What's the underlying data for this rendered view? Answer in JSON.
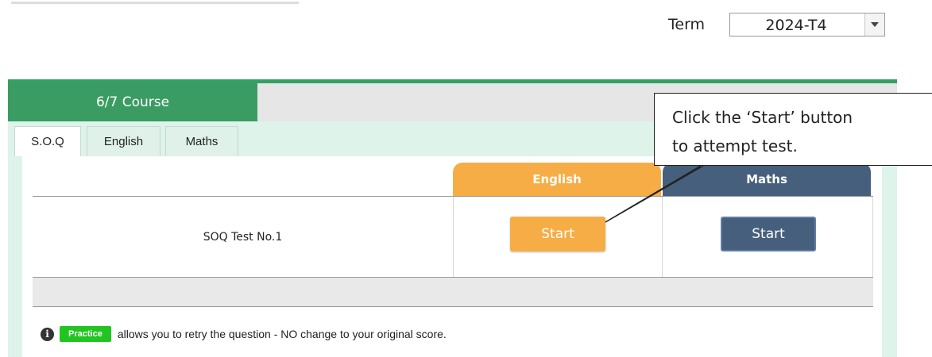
{
  "term": {
    "label": "Term",
    "value": "2024-T4"
  },
  "course": {
    "tab_label": "6/7 Course",
    "subtabs": [
      "S.O.Q",
      "English",
      "Maths"
    ],
    "active_subtab": "S.O.Q"
  },
  "table": {
    "columns": [
      "English",
      "Maths"
    ],
    "rows": [
      {
        "name": "SOQ Test No.1",
        "english_button": "Start",
        "maths_button": "Start"
      }
    ]
  },
  "info": {
    "badge": "Practice",
    "text": "allows you to retry the question - NO change to your original score."
  },
  "callout": {
    "line1": "Click the ‘Start’ button",
    "line2": "to attempt test."
  },
  "colors": {
    "course_green": "#3a9c62",
    "english_orange": "#f7ad45",
    "maths_navy": "#465f7c",
    "practice_green": "#20c520",
    "inner_mint": "#def3ea"
  }
}
